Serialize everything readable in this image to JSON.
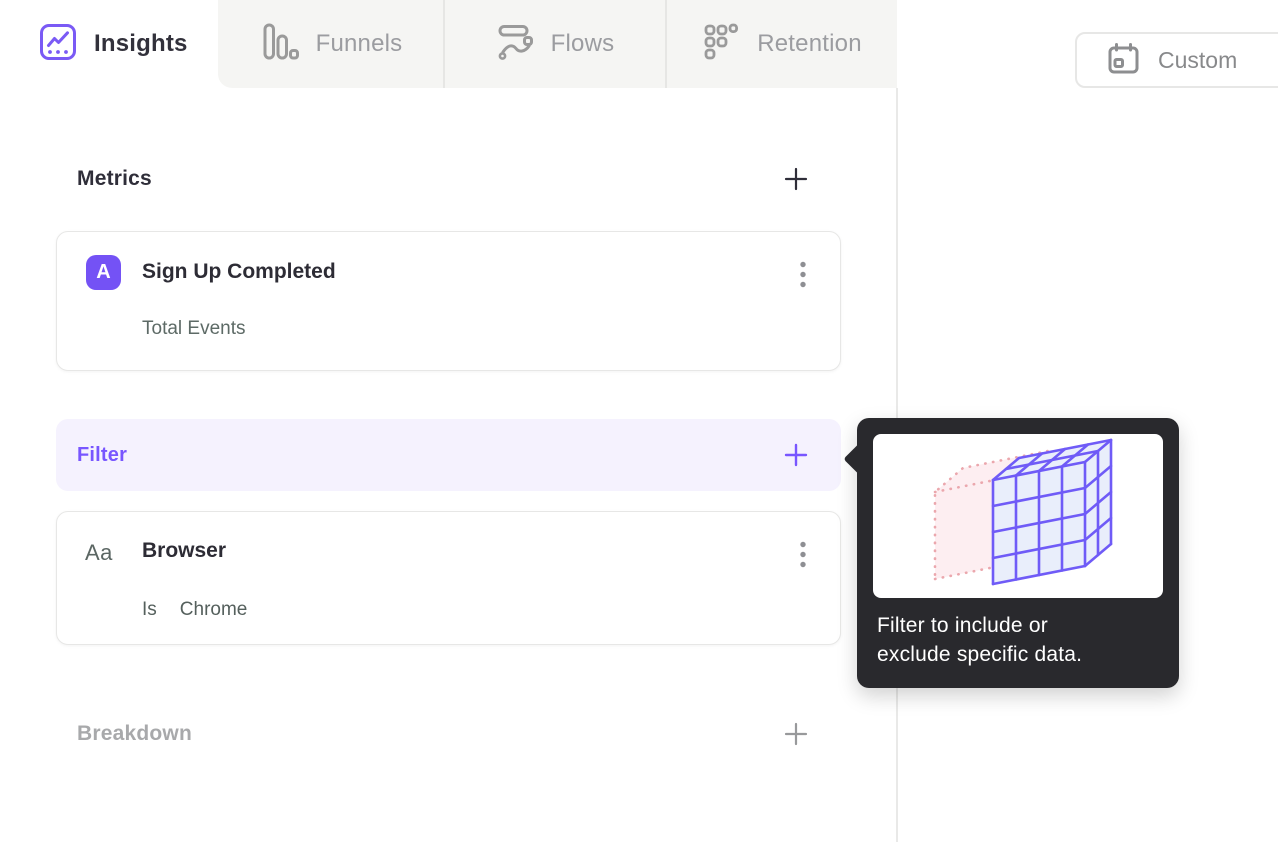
{
  "tabs": [
    {
      "label": "Insights",
      "active": true
    },
    {
      "label": "Funnels",
      "active": false
    },
    {
      "label": "Flows",
      "active": false
    },
    {
      "label": "Retention",
      "active": false
    }
  ],
  "toolbar": {
    "date_range_label": "Custom"
  },
  "panel": {
    "metrics_section": {
      "title": "Metrics",
      "add_icon": "plus-icon"
    },
    "metric_card": {
      "badge": "A",
      "title": "Sign Up Completed",
      "subtitle": "Total Events"
    },
    "filter_section": {
      "title": "Filter",
      "add_icon": "plus-icon"
    },
    "filter_card": {
      "type_icon_text": "Aa",
      "title": "Browser",
      "operator": "Is",
      "value": "Chrome"
    },
    "breakdown_section": {
      "title": "Breakdown",
      "add_icon": "plus-icon"
    }
  },
  "tooltip": {
    "line1": "Filter to include or",
    "line2": "exclude specific data."
  },
  "colors": {
    "accent_purple": "#7856ff",
    "badge_purple": "#7452f5",
    "filter_row_bg": "#f5f2fe",
    "tab_strip_bg": "#f5f5f3",
    "tooltip_bg": "#29292d",
    "dark_text": "#2d2c35",
    "muted_text": "#9b9ca0",
    "subtitle_text": "#5d6a66",
    "illustration_pink": "#eba7ad",
    "illustration_blue_fill": "#e9eefb"
  }
}
